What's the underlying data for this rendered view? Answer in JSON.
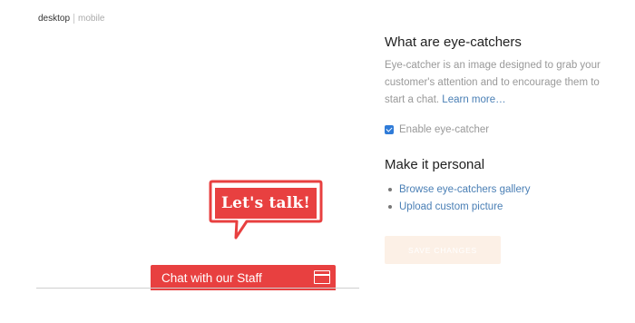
{
  "view_toggle": {
    "desktop": "desktop",
    "mobile": "mobile"
  },
  "preview": {
    "eye_catcher_text": "Let's talk!",
    "chat_bar_label": "Chat with our Staff",
    "colors": {
      "accent": "#e84040",
      "bar": "#e84040"
    }
  },
  "info": {
    "title": "What are eye-catchers",
    "description": "Eye-catcher is an image designed to grab your customer's attention and to encourage them to start a chat.",
    "learn_more": "Learn more…"
  },
  "settings": {
    "enable_label": "Enable eye-catcher",
    "enable_checked": true
  },
  "personal": {
    "title": "Make it personal",
    "links": [
      "Browse eye-catchers gallery",
      "Upload custom picture"
    ]
  },
  "save_button": "SAVE CHANGES",
  "colors": {
    "link": "#4a7fb5",
    "checkbox": "#2f7bd8",
    "save_button_bg": "#fcf0e6"
  }
}
